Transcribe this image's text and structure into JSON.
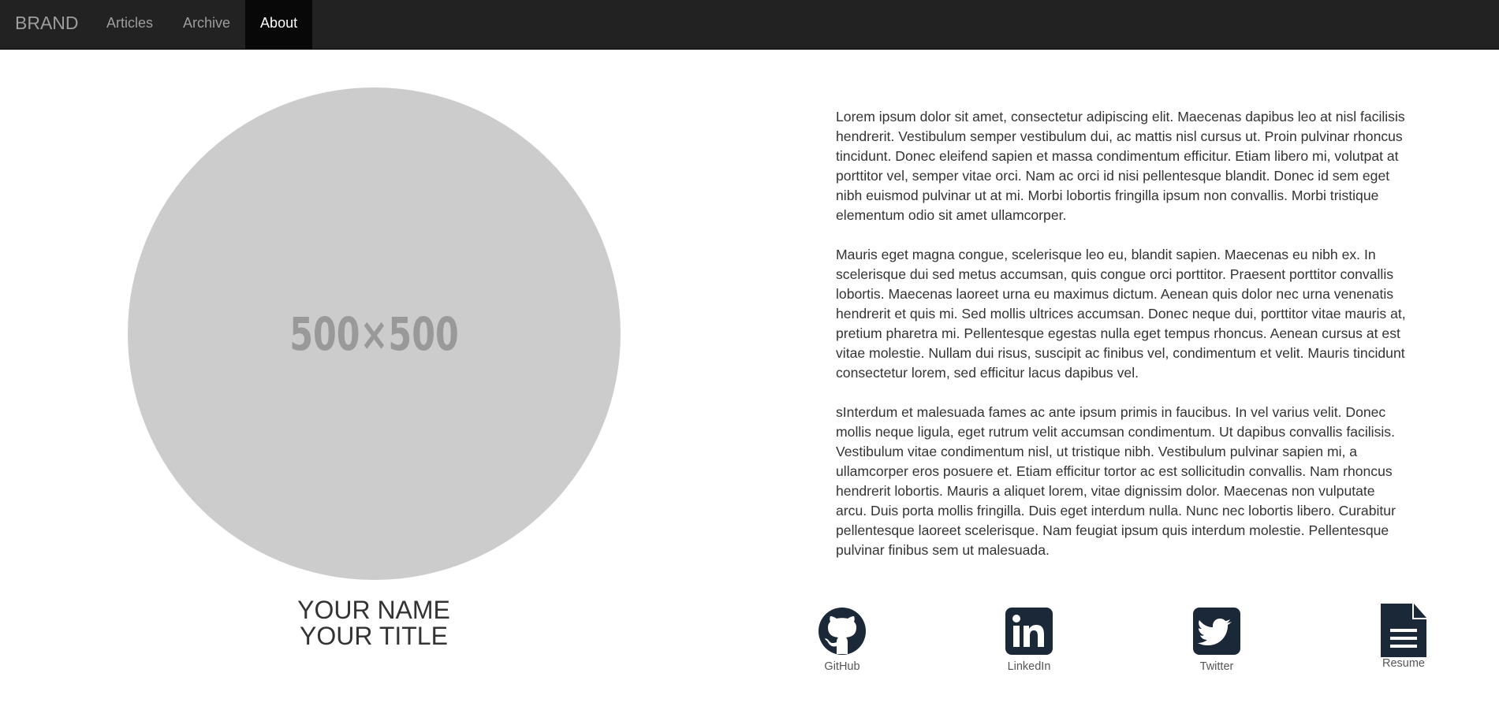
{
  "nav": {
    "brand": "BRAND",
    "items": [
      {
        "label": "Articles",
        "active": false
      },
      {
        "label": "Archive",
        "active": false
      },
      {
        "label": "About",
        "active": true
      }
    ]
  },
  "profile": {
    "avatar_placeholder": "500×500",
    "name": "YOUR NAME",
    "title": "YOUR TITLE"
  },
  "bio": {
    "paragraphs": [
      "Lorem ipsum dolor sit amet, consectetur adipiscing elit. Maecenas dapibus leo at nisl facilisis hendrerit. Vestibulum semper vestibulum dui, ac mattis nisl cursus ut. Proin pulvinar rhoncus tincidunt. Donec eleifend sapien et massa condimentum efficitur. Etiam libero mi, volutpat at porttitor vel, semper vitae orci. Nam ac orci id nisi pellentesque blandit. Donec id sem eget nibh euismod pulvinar ut at mi. Morbi lobortis fringilla ipsum non convallis. Morbi tristique elementum odio sit amet ullamcorper.",
      "Mauris eget magna congue, scelerisque leo eu, blandit sapien. Maecenas eu nibh ex. In scelerisque dui sed metus accumsan, quis congue orci porttitor. Praesent porttitor convallis lobortis. Maecenas laoreet urna eu maximus dictum. Aenean quis dolor nec urna venenatis hendrerit et quis mi. Sed mollis ultrices accumsan. Donec neque dui, porttitor vitae mauris at, pretium pharetra mi. Pellentesque egestas nulla eget tempus rhoncus. Aenean cursus at est vitae molestie. Nullam dui risus, suscipit ac finibus vel, condimentum et velit. Mauris tincidunt consectetur lorem, sed efficitur lacus dapibus vel.",
      "sInterdum et malesuada fames ac ante ipsum primis in faucibus. In vel varius velit. Donec mollis neque ligula, eget rutrum velit accumsan condimentum. Ut dapibus convallis facilisis. Vestibulum vitae condimentum nisl, ut tristique nibh. Vestibulum pulvinar sapien mi, a ullamcorper eros posuere et. Etiam efficitur tortor ac est sollicitudin convallis. Nam rhoncus hendrerit lobortis. Mauris a aliquet lorem, vitae dignissim dolor. Maecenas non vulputate arcu. Duis porta mollis fringilla. Duis eget interdum nulla. Nunc nec lobortis libero. Curabitur pellentesque laoreet scelerisque. Nam feugiat ipsum quis interdum molestie. Pellentesque pulvinar finibus sem ut malesuada."
    ]
  },
  "social": [
    {
      "label": "GitHub",
      "icon": "github-icon"
    },
    {
      "label": "LinkedIn",
      "icon": "linkedin-icon"
    },
    {
      "label": "Twitter",
      "icon": "twitter-icon"
    },
    {
      "label": "Resume",
      "icon": "document-icon"
    }
  ],
  "colors": {
    "navbar_bg": "#222222",
    "navbar_active_bg": "#080808",
    "nav_text": "#9d9d9d",
    "avatar_bg": "#cccccc",
    "avatar_text": "#999999",
    "icon_color": "#1b2838",
    "body_text": "#333333"
  }
}
